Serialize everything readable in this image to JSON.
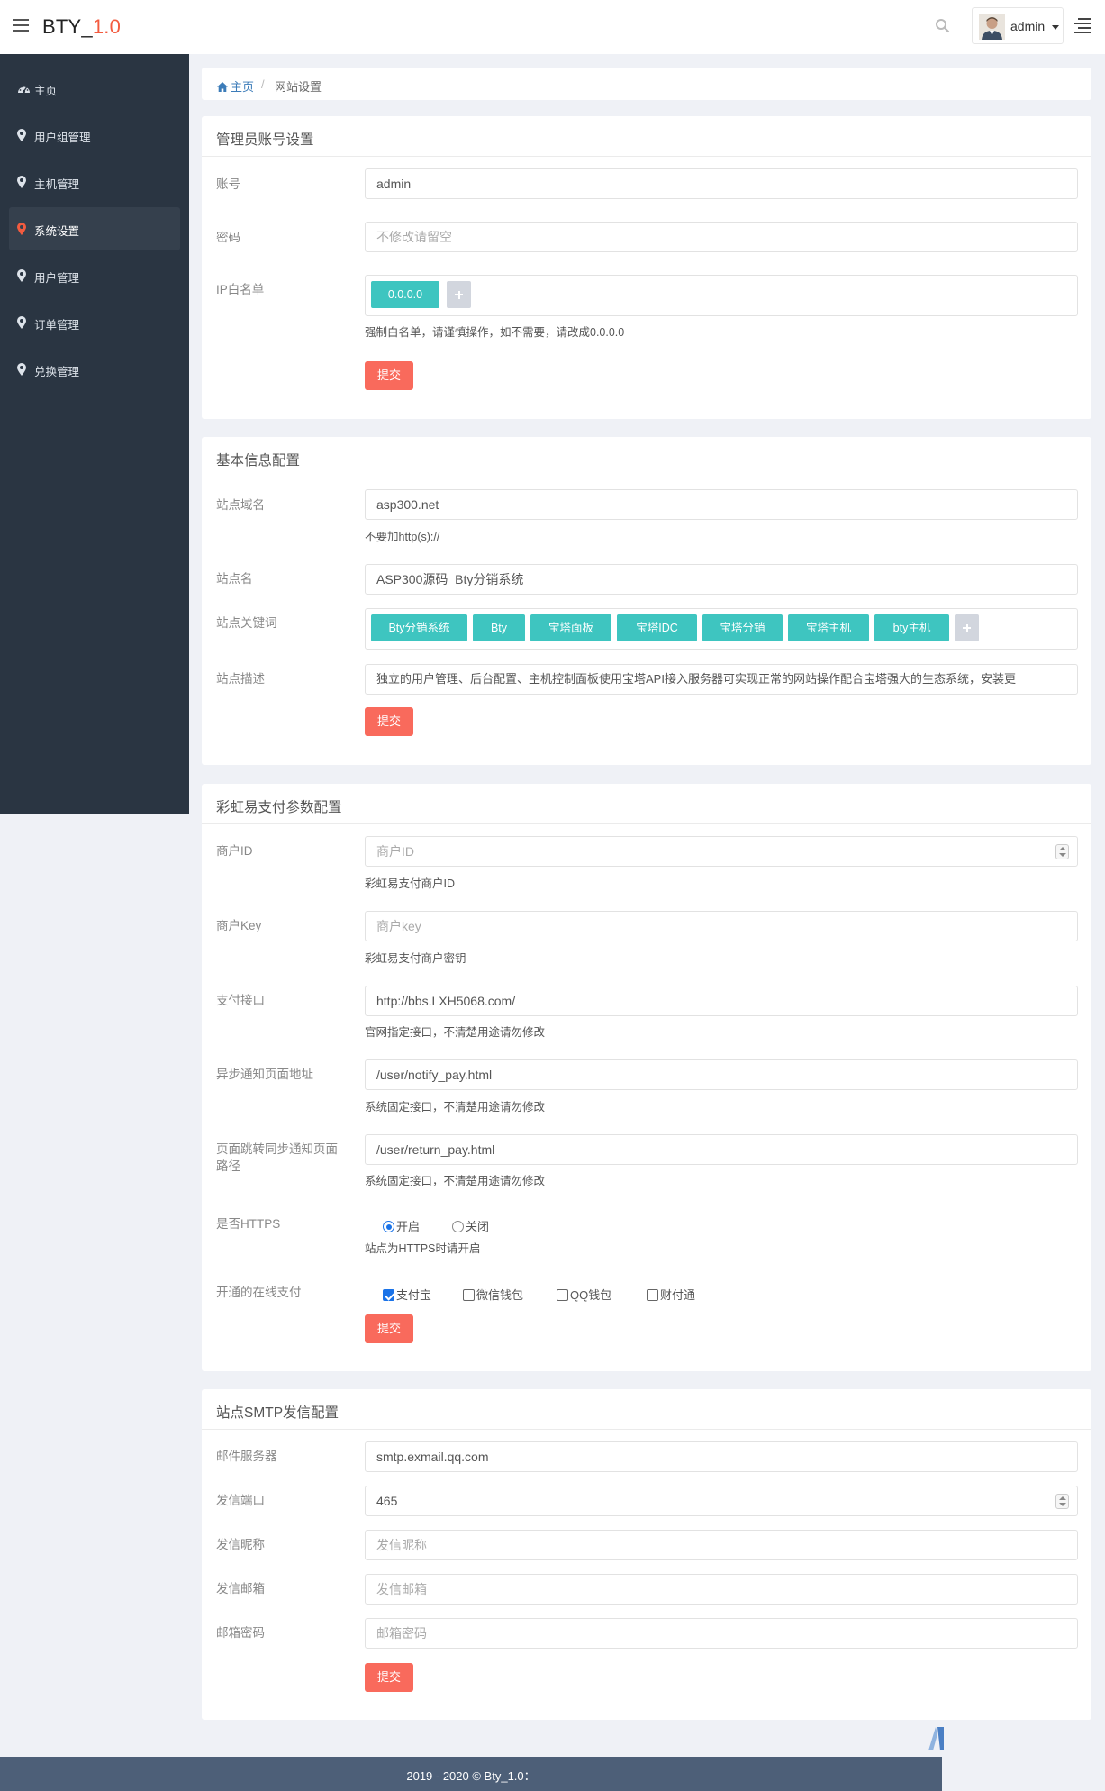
{
  "app": {
    "brand_name": "BTY_",
    "brand_version": "1.0"
  },
  "header": {
    "user_name": "admin"
  },
  "sidebar": {
    "items": [
      {
        "label": "主页",
        "icon": "dashboard-icon"
      },
      {
        "label": "用户组管理",
        "icon": "map-marker-icon"
      },
      {
        "label": "主机管理",
        "icon": "map-marker-icon"
      },
      {
        "label": "系统设置",
        "icon": "map-marker-icon",
        "active": true
      },
      {
        "label": "用户管理",
        "icon": "map-marker-icon"
      },
      {
        "label": "订单管理",
        "icon": "map-marker-icon"
      },
      {
        "label": "兑换管理",
        "icon": "map-marker-icon"
      }
    ]
  },
  "breadcrumb": {
    "home": "主页",
    "separator": "/",
    "current": "网站设置"
  },
  "admin_panel": {
    "title": "管理员账号设置",
    "account_label": "账号",
    "account_value": "admin",
    "password_label": "密码",
    "password_placeholder": "不修改请留空",
    "ip_label": "IP白名单",
    "ip_tags": [
      "0.0.0.0"
    ],
    "ip_help": "强制白名单，请谨慎操作，如不需要，请改成0.0.0.0",
    "submit": "提交"
  },
  "basic_panel": {
    "title": "基本信息配置",
    "domain_label": "站点域名",
    "domain_value": "asp300.net",
    "domain_help": "不要加http(s)://",
    "name_label": "站点名",
    "name_value": "ASP300源码_Bty分销系统",
    "keywords_label": "站点关键词",
    "keywords": [
      "Bty分销系统",
      "Bty",
      "宝塔面板",
      "宝塔IDC",
      "宝塔分销",
      "宝塔主机",
      "bty主机"
    ],
    "desc_label": "站点描述",
    "desc_value": "独立的用户管理、后台配置、主机控制面板使用宝塔API接入服务器可实现正常的网站操作配合宝塔强大的生态系统，安装更",
    "submit": "提交"
  },
  "pay_panel": {
    "title": "彩虹易支付参数配置",
    "merchant_id_label": "商户ID",
    "merchant_id_placeholder": "商户ID",
    "merchant_id_help": "彩虹易支付商户ID",
    "merchant_key_label": "商户Key",
    "merchant_key_placeholder": "商户key",
    "merchant_key_help": "彩虹易支付商户密钥",
    "gateway_label": "支付接口",
    "gateway_value": "http://bbs.LXH5068.com/",
    "gateway_help": "官网指定接口，不清楚用途请勿修改",
    "notify_label": "异步通知页面地址",
    "notify_value": "/user/notify_pay.html",
    "notify_help": "系统固定接口，不清楚用途请勿修改",
    "return_label": "页面跳转同步通知页面路径",
    "return_value": "/user/return_pay.html",
    "return_help": "系统固定接口，不清楚用途请勿修改",
    "https_label": "是否HTTPS",
    "https_on": "开启",
    "https_off": "关闭",
    "https_selected": "开启",
    "https_help": "站点为HTTPS时请开启",
    "methods_label": "开通的在线支付",
    "methods": [
      {
        "label": "支付宝",
        "checked": true
      },
      {
        "label": "微信钱包",
        "checked": false
      },
      {
        "label": "QQ钱包",
        "checked": false
      },
      {
        "label": "财付通",
        "checked": false
      }
    ],
    "submit": "提交"
  },
  "smtp_panel": {
    "title": "站点SMTP发信配置",
    "server_label": "邮件服务器",
    "server_value": "smtp.exmail.qq.com",
    "port_label": "发信端口",
    "port_value": "465",
    "nickname_label": "发信昵称",
    "nickname_placeholder": "发信昵称",
    "email_label": "发信邮箱",
    "email_placeholder": "发信邮箱",
    "password_label": "邮箱密码",
    "password_placeholder": "邮箱密码",
    "submit": "提交"
  },
  "footer": {
    "text": "2019 - 2020 © Bty_1.0："
  },
  "colors": {
    "sidebar_bg": "#2a3542",
    "sidebar_active": "#35404d",
    "accent_red": "#f35b3f",
    "submit_button": "#f96a5c",
    "tag_teal": "#3ec5c0",
    "footer_bg": "#4d5f78",
    "link_blue": "#3c7cb9"
  }
}
